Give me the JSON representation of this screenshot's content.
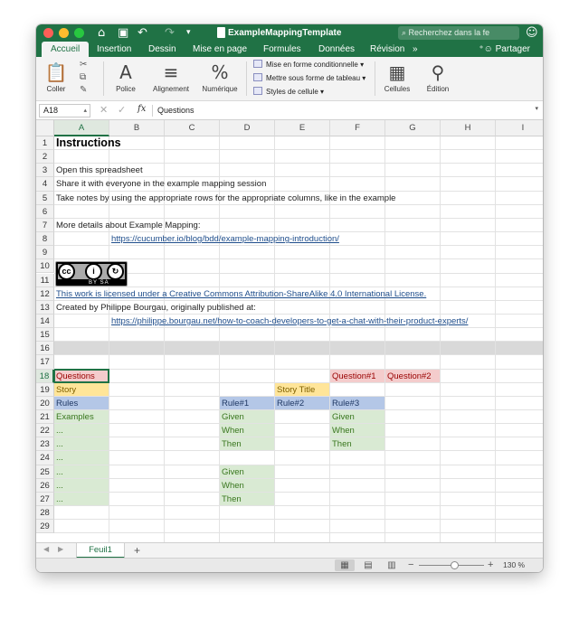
{
  "window": {
    "title": "ExampleMappingTemplate",
    "search_placeholder": "Recherchez dans la fe",
    "share_label": "Partager"
  },
  "ribbon_tabs": [
    "Accueil",
    "Insertion",
    "Dessin",
    "Mise en page",
    "Formules",
    "Données",
    "Révision",
    "»"
  ],
  "ribbon": {
    "paste": "Coller",
    "font": "Police",
    "alignment": "Alignement",
    "number": "Numérique",
    "conditional_format": "Mise en forme conditionnelle",
    "format_as_table": "Mettre sous forme de tableau",
    "cell_styles": "Styles de cellule",
    "cells": "Cellules",
    "editing": "Édition"
  },
  "formula_bar": {
    "name_box": "A18",
    "fx": "fx",
    "content": "Questions"
  },
  "columns": [
    "A",
    "B",
    "C",
    "D",
    "E",
    "F",
    "G",
    "H",
    "I"
  ],
  "selected_column": "A",
  "rows": [
    "1",
    "2",
    "3",
    "4",
    "5",
    "6",
    "7",
    "8",
    "9",
    "10",
    "11",
    "12",
    "13",
    "14",
    "15",
    "16",
    "17",
    "18",
    "19",
    "20",
    "21",
    "22",
    "23",
    "24",
    "25",
    "26",
    "27",
    "28",
    "29"
  ],
  "selected_row": "18",
  "cells": {
    "r1": "Instructions",
    "r3": "Open this spreadsheet",
    "r4": "Share it with everyone in the example mapping session",
    "r5": "Take notes by using the appropriate rows for the appropriate columns, like in the example",
    "r7": "More details about Example Mapping:",
    "r8": "https://cucumber.io/blog/bdd/example-mapping-introduction/",
    "r12": "This work is licensed under a Creative Commons Attribution-ShareAlike 4.0 International License.",
    "r13": "Created by Philippe Bourgau, originally published at:",
    "r14": "https://philippe.bourgau.net/how-to-coach-developers-to-get-a-chat-with-their-product-experts/",
    "a18": "Questions",
    "f18": "Question#1",
    "g18": "Question#2",
    "a19": "Story",
    "e19": "Story Title",
    "a20": "Rules",
    "d20": "Rule#1",
    "e20": "Rule#2",
    "f20": "Rule#3",
    "a21": "Examples",
    "a22": "...",
    "a23": "...",
    "a24": "...",
    "a25": "...",
    "a26": "...",
    "a27": "...",
    "d21": "Given",
    "d22": "When",
    "d23": "Then",
    "f21": "Given",
    "f22": "When",
    "f23": "Then",
    "d25": "Given",
    "d26": "When",
    "d27": "Then"
  },
  "cc_badge": {
    "text": "BY  SA"
  },
  "colors": {
    "excel_green": "#207245",
    "questions_red": "#f4cccc",
    "questions_text": "#990000",
    "story_yellow": "#ffe599",
    "story_text": "#7f6000",
    "rules_blue": "#b4c7e7",
    "rules_text": "#1f3864",
    "examples_green": "#d9ead3",
    "examples_text": "#38761d",
    "separator_gray": "#d9d9d9"
  },
  "sheet_tabs": [
    "Feuil1"
  ],
  "add_sheet": "+",
  "status": {
    "zoom_label": "130 %",
    "zoom_percent": 130
  }
}
